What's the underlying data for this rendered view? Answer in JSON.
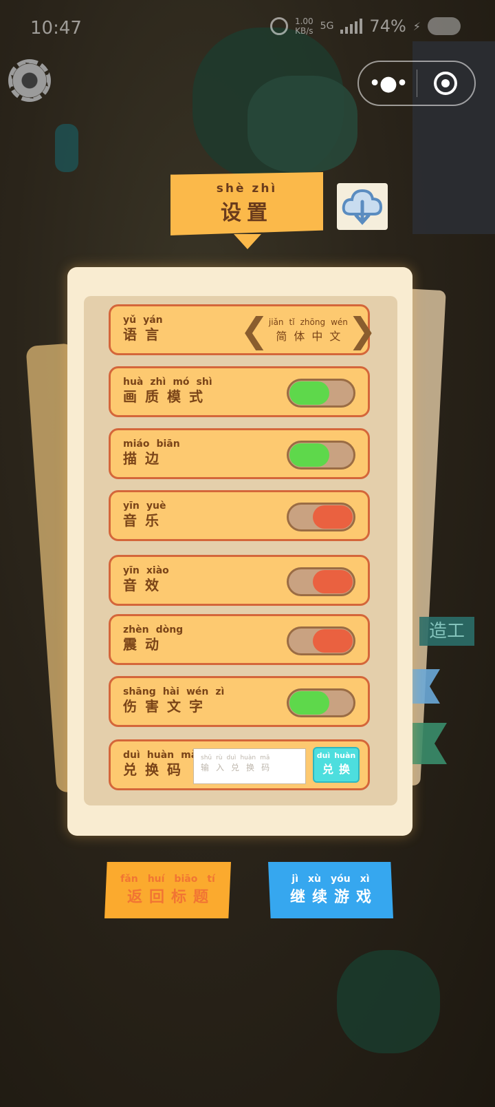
{
  "status_bar": {
    "time": "10:47",
    "net_speed": "1.00",
    "net_unit": "KB/s",
    "network_type": "5G",
    "battery": "74%"
  },
  "title": {
    "pinyin": [
      "shè",
      "zhì"
    ],
    "text": [
      "设",
      "置"
    ]
  },
  "settings": [
    {
      "label_pinyin": [
        "yǔ",
        "yán"
      ],
      "label_text": [
        "语",
        "言"
      ],
      "value_pinyin": [
        "jiǎn",
        "tǐ",
        "zhōng",
        "wén"
      ],
      "value_text": [
        "简",
        "体",
        "中",
        "文"
      ]
    },
    {
      "label_pinyin": [
        "huà",
        "zhì",
        "mó",
        "shì"
      ],
      "label_text": [
        "画",
        "质",
        "模",
        "式"
      ],
      "state": "on"
    },
    {
      "label_pinyin": [
        "miáo",
        "biān"
      ],
      "label_text": [
        "描",
        "边"
      ],
      "state": "on"
    },
    {
      "label_pinyin": [
        "yīn",
        "yuè"
      ],
      "label_text": [
        "音",
        "乐"
      ],
      "state": "off"
    },
    {
      "label_pinyin": [
        "yīn",
        "xiào"
      ],
      "label_text": [
        "音",
        "效"
      ],
      "state": "off"
    },
    {
      "label_pinyin": [
        "zhèn",
        "dòng"
      ],
      "label_text": [
        "震",
        "动"
      ],
      "state": "off"
    },
    {
      "label_pinyin": [
        "shāng",
        "hài",
        "wén",
        "zì"
      ],
      "label_text": [
        "伤",
        "害",
        "文",
        "字"
      ],
      "state": "on"
    }
  ],
  "redeem": {
    "label_pinyin": [
      "duì",
      "huàn",
      "mǎ"
    ],
    "label_text": [
      "兑",
      "换",
      "码"
    ],
    "placeholder_pinyin": [
      "shū",
      "rù",
      "duì",
      "huàn",
      "mǎ"
    ],
    "placeholder_text": [
      "输",
      "入",
      "兑",
      "换",
      "码"
    ],
    "button_pinyin": [
      "duì",
      "huàn"
    ],
    "button_text": [
      "兑",
      "换"
    ]
  },
  "buttons": {
    "back_title_pinyin": [
      "fǎn",
      "huí",
      "biāo",
      "tí"
    ],
    "back_title_text": [
      "返",
      "回",
      "标",
      "题"
    ],
    "continue_pinyin": [
      "jì",
      "xù",
      "yóu",
      "xì"
    ],
    "continue_text": [
      "继",
      "续",
      "游",
      "戏"
    ]
  },
  "background_sign": "造工",
  "colors": {
    "toggle_on": "#5ed84b",
    "toggle_off": "#ea6140",
    "accent_orange": "#fbaa2e",
    "accent_blue": "#36a7ef"
  },
  "icons": [
    "gear-icon",
    "more-icon",
    "close-target-icon",
    "cloud-download-icon",
    "chevron-left-icon",
    "chevron-right-icon"
  ]
}
